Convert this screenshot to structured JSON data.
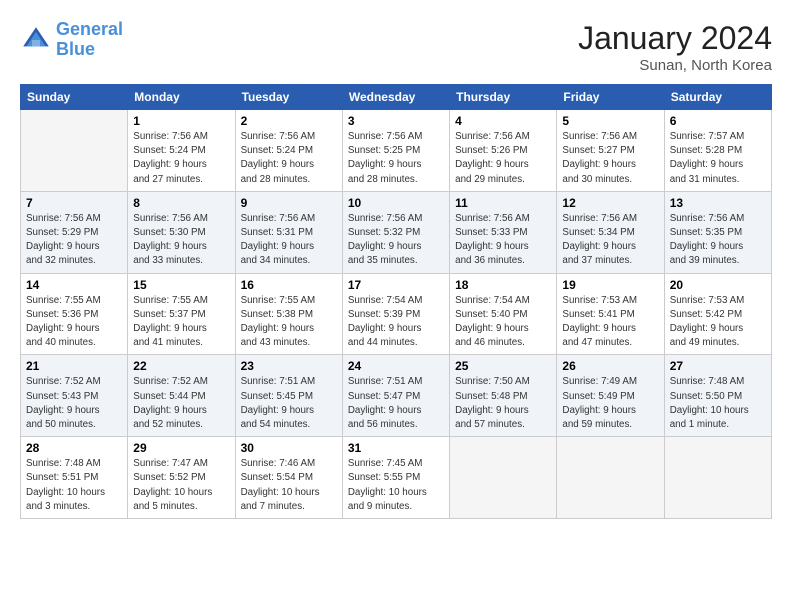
{
  "header": {
    "logo_line1": "General",
    "logo_line2": "Blue",
    "month": "January 2024",
    "location": "Sunan, North Korea"
  },
  "weekdays": [
    "Sunday",
    "Monday",
    "Tuesday",
    "Wednesday",
    "Thursday",
    "Friday",
    "Saturday"
  ],
  "weeks": [
    [
      {
        "day": "",
        "info": ""
      },
      {
        "day": "1",
        "info": "Sunrise: 7:56 AM\nSunset: 5:24 PM\nDaylight: 9 hours\nand 27 minutes."
      },
      {
        "day": "2",
        "info": "Sunrise: 7:56 AM\nSunset: 5:24 PM\nDaylight: 9 hours\nand 28 minutes."
      },
      {
        "day": "3",
        "info": "Sunrise: 7:56 AM\nSunset: 5:25 PM\nDaylight: 9 hours\nand 28 minutes."
      },
      {
        "day": "4",
        "info": "Sunrise: 7:56 AM\nSunset: 5:26 PM\nDaylight: 9 hours\nand 29 minutes."
      },
      {
        "day": "5",
        "info": "Sunrise: 7:56 AM\nSunset: 5:27 PM\nDaylight: 9 hours\nand 30 minutes."
      },
      {
        "day": "6",
        "info": "Sunrise: 7:57 AM\nSunset: 5:28 PM\nDaylight: 9 hours\nand 31 minutes."
      }
    ],
    [
      {
        "day": "7",
        "info": "Sunrise: 7:56 AM\nSunset: 5:29 PM\nDaylight: 9 hours\nand 32 minutes."
      },
      {
        "day": "8",
        "info": "Sunrise: 7:56 AM\nSunset: 5:30 PM\nDaylight: 9 hours\nand 33 minutes."
      },
      {
        "day": "9",
        "info": "Sunrise: 7:56 AM\nSunset: 5:31 PM\nDaylight: 9 hours\nand 34 minutes."
      },
      {
        "day": "10",
        "info": "Sunrise: 7:56 AM\nSunset: 5:32 PM\nDaylight: 9 hours\nand 35 minutes."
      },
      {
        "day": "11",
        "info": "Sunrise: 7:56 AM\nSunset: 5:33 PM\nDaylight: 9 hours\nand 36 minutes."
      },
      {
        "day": "12",
        "info": "Sunrise: 7:56 AM\nSunset: 5:34 PM\nDaylight: 9 hours\nand 37 minutes."
      },
      {
        "day": "13",
        "info": "Sunrise: 7:56 AM\nSunset: 5:35 PM\nDaylight: 9 hours\nand 39 minutes."
      }
    ],
    [
      {
        "day": "14",
        "info": "Sunrise: 7:55 AM\nSunset: 5:36 PM\nDaylight: 9 hours\nand 40 minutes."
      },
      {
        "day": "15",
        "info": "Sunrise: 7:55 AM\nSunset: 5:37 PM\nDaylight: 9 hours\nand 41 minutes."
      },
      {
        "day": "16",
        "info": "Sunrise: 7:55 AM\nSunset: 5:38 PM\nDaylight: 9 hours\nand 43 minutes."
      },
      {
        "day": "17",
        "info": "Sunrise: 7:54 AM\nSunset: 5:39 PM\nDaylight: 9 hours\nand 44 minutes."
      },
      {
        "day": "18",
        "info": "Sunrise: 7:54 AM\nSunset: 5:40 PM\nDaylight: 9 hours\nand 46 minutes."
      },
      {
        "day": "19",
        "info": "Sunrise: 7:53 AM\nSunset: 5:41 PM\nDaylight: 9 hours\nand 47 minutes."
      },
      {
        "day": "20",
        "info": "Sunrise: 7:53 AM\nSunset: 5:42 PM\nDaylight: 9 hours\nand 49 minutes."
      }
    ],
    [
      {
        "day": "21",
        "info": "Sunrise: 7:52 AM\nSunset: 5:43 PM\nDaylight: 9 hours\nand 50 minutes."
      },
      {
        "day": "22",
        "info": "Sunrise: 7:52 AM\nSunset: 5:44 PM\nDaylight: 9 hours\nand 52 minutes."
      },
      {
        "day": "23",
        "info": "Sunrise: 7:51 AM\nSunset: 5:45 PM\nDaylight: 9 hours\nand 54 minutes."
      },
      {
        "day": "24",
        "info": "Sunrise: 7:51 AM\nSunset: 5:47 PM\nDaylight: 9 hours\nand 56 minutes."
      },
      {
        "day": "25",
        "info": "Sunrise: 7:50 AM\nSunset: 5:48 PM\nDaylight: 9 hours\nand 57 minutes."
      },
      {
        "day": "26",
        "info": "Sunrise: 7:49 AM\nSunset: 5:49 PM\nDaylight: 9 hours\nand 59 minutes."
      },
      {
        "day": "27",
        "info": "Sunrise: 7:48 AM\nSunset: 5:50 PM\nDaylight: 10 hours\nand 1 minute."
      }
    ],
    [
      {
        "day": "28",
        "info": "Sunrise: 7:48 AM\nSunset: 5:51 PM\nDaylight: 10 hours\nand 3 minutes."
      },
      {
        "day": "29",
        "info": "Sunrise: 7:47 AM\nSunset: 5:52 PM\nDaylight: 10 hours\nand 5 minutes."
      },
      {
        "day": "30",
        "info": "Sunrise: 7:46 AM\nSunset: 5:54 PM\nDaylight: 10 hours\nand 7 minutes."
      },
      {
        "day": "31",
        "info": "Sunrise: 7:45 AM\nSunset: 5:55 PM\nDaylight: 10 hours\nand 9 minutes."
      },
      {
        "day": "",
        "info": ""
      },
      {
        "day": "",
        "info": ""
      },
      {
        "day": "",
        "info": ""
      }
    ]
  ]
}
